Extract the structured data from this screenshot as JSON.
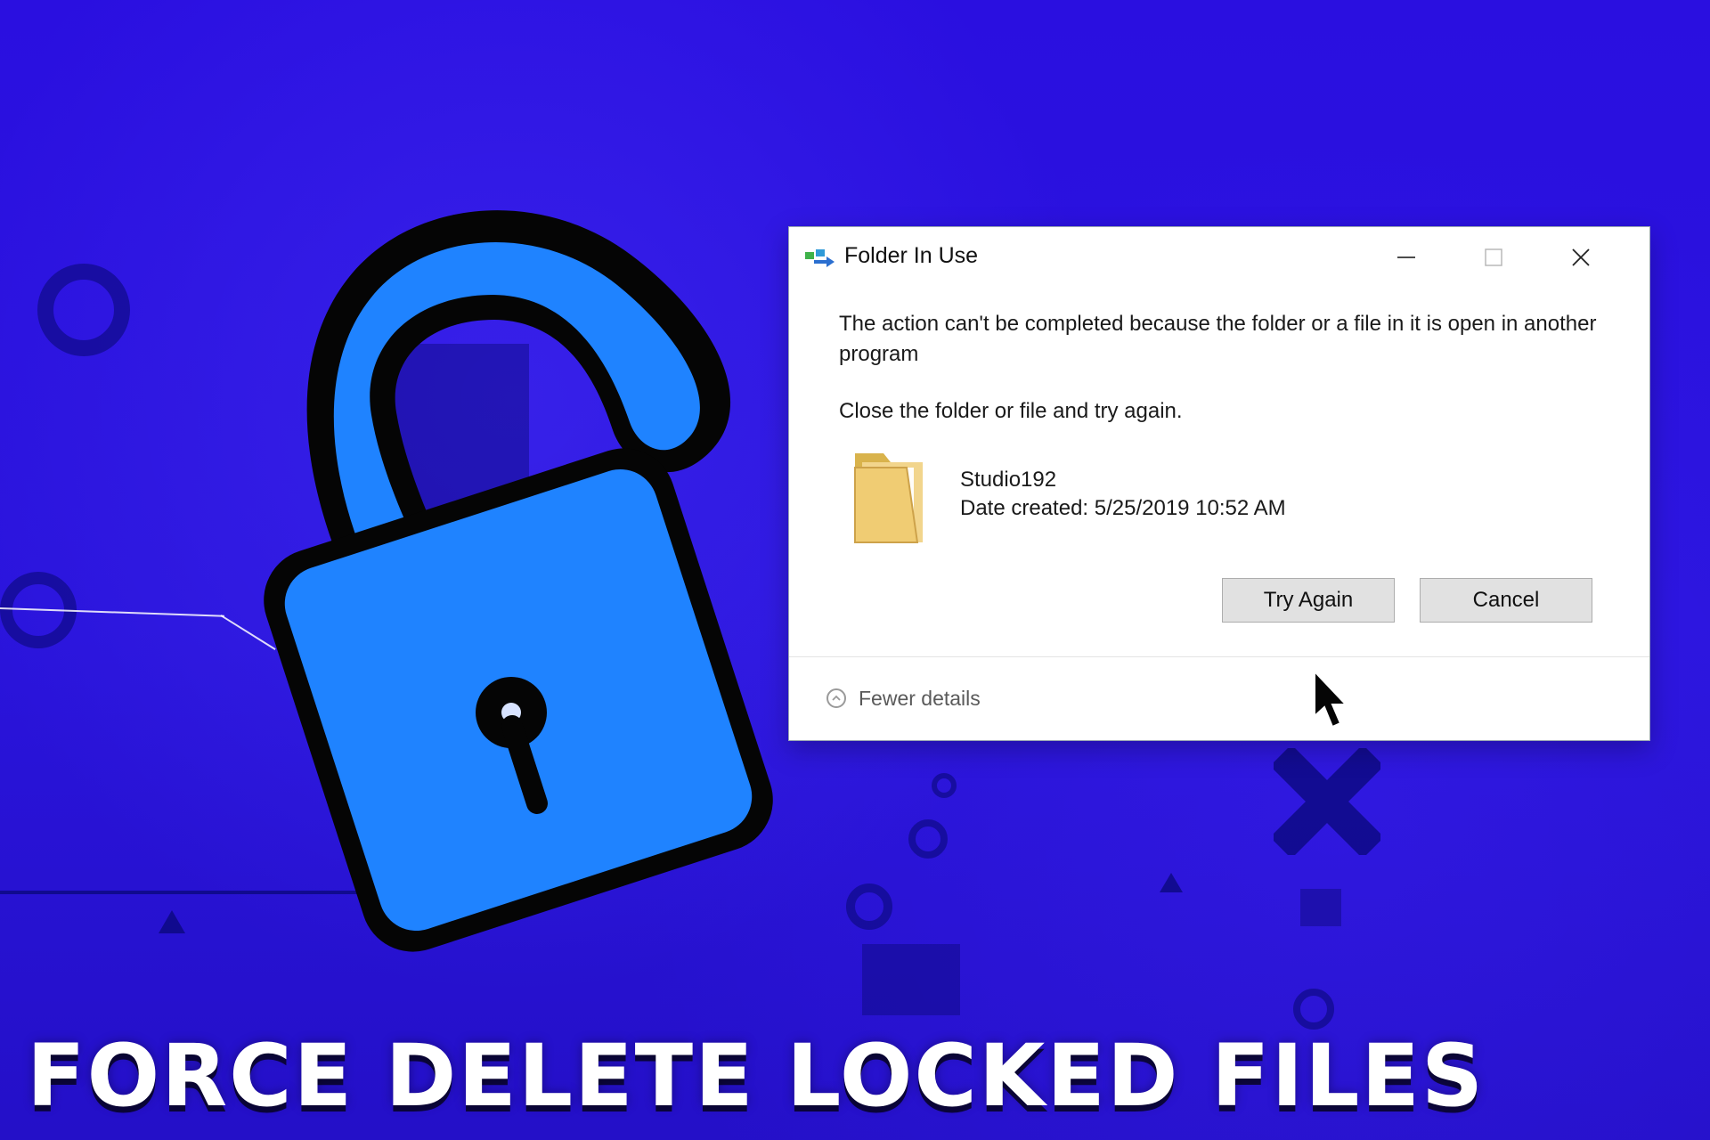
{
  "scene": {
    "background_color": "#2a12d6",
    "accent_blue": "#1f83ff",
    "outline_color": "#050505"
  },
  "lock": {
    "icon_name": "unlocked-padlock-icon"
  },
  "dialog": {
    "title": "Folder In Use",
    "title_icon": "folder-transfer-icon",
    "controls": {
      "minimize_icon": "minimize-icon",
      "maximize_icon": "maximize-icon",
      "close_icon": "close-icon"
    },
    "message_primary": "The action can't be completed because the folder or a file in it is open in another program",
    "message_secondary": "Close the folder or file and try again.",
    "file": {
      "icon": "folder-icon",
      "name": "Studio192",
      "date_created": "Date created: 5/25/2019 10:52 AM"
    },
    "buttons": {
      "try_again": "Try Again",
      "cancel": "Cancel"
    },
    "details_toggle": "Fewer details",
    "details_toggle_icon": "chevron-up-icon"
  },
  "cursor": {
    "icon": "mouse-pointer-icon"
  },
  "headline": {
    "text": "FORCE DELETE LOCKED FILES"
  }
}
